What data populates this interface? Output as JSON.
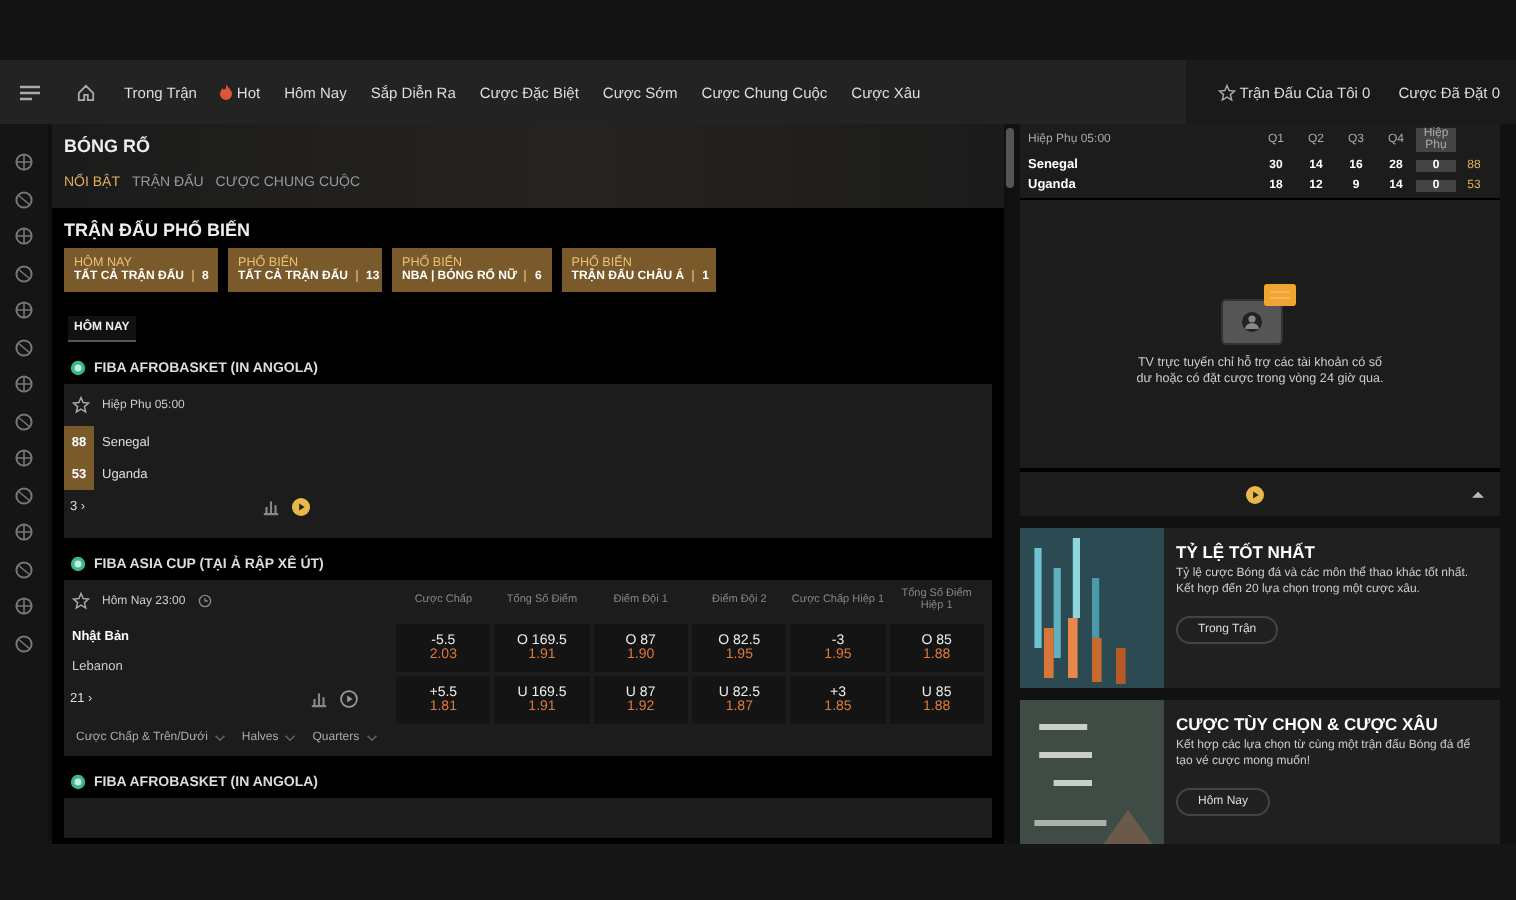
{
  "nav": {
    "items": [
      {
        "label": "Trong Trận",
        "kind": "text"
      },
      {
        "label": "Hot",
        "kind": "hot"
      },
      {
        "label": "Hôm Nay",
        "kind": "text"
      },
      {
        "label": "Sắp Diễn Ra",
        "kind": "text"
      },
      {
        "label": "Cược Đặc Biệt",
        "kind": "text"
      },
      {
        "label": "Cược Sớm",
        "kind": "text"
      },
      {
        "label": "Cược Chung Cuộc",
        "kind": "text"
      },
      {
        "label": "Cược Xâu",
        "kind": "text"
      }
    ],
    "my_matches": "Trận Đấu Của Tôi 0",
    "placed_bets": "Cược Đã Đặt 0"
  },
  "sport": {
    "title": "BÓNG RỔ",
    "tabs": [
      {
        "label": "NỔI BẬT",
        "selected": true
      },
      {
        "label": "TRẬN ĐẤU",
        "selected": false
      },
      {
        "label": "CƯỢC CHUNG CUỘC",
        "selected": false
      }
    ]
  },
  "popular": {
    "title": "TRẬN ĐẤU PHỔ BIẾN",
    "cards": [
      {
        "label": "HÔM NAY",
        "title": "TẤT CẢ TRẬN ĐẤU",
        "count": "8"
      },
      {
        "label": "PHỔ BIẾN",
        "title": "TẤT CẢ TRẬN ĐẤU",
        "count": "13"
      },
      {
        "label": "PHỔ BIẾN",
        "title": "NBA | BÓNG RỔ NỮ",
        "count": "6"
      },
      {
        "label": "PHỔ BIẾN",
        "title": "TRẬN ĐẤU CHÂU Á",
        "count": "1"
      }
    ]
  },
  "day_chip": "HÔM NAY",
  "leagues": [
    {
      "name": "FIBA AFROBASKET (IN ANGOLA)",
      "kind": "live",
      "status": "Hiệp Phụ 05:00",
      "teams": [
        {
          "name": "Senegal",
          "score": "88"
        },
        {
          "name": "Uganda",
          "score": "53"
        }
      ],
      "more": "3 ›"
    },
    {
      "name": "FIBA ASIA CUP (TẠI Ả RẬP XÊ ÚT)",
      "kind": "odds",
      "status": "Hôm Nay 23:00",
      "columns": [
        "Cược Chấp",
        "Tổng Số Điểm",
        "Điểm Đội 1",
        "Điểm Đội 2",
        "Cược Chấp Hiệp 1",
        "Tổng Số Điểm Hiệp 1"
      ],
      "teams": [
        {
          "name": "Nhật Bản",
          "bold": true
        },
        {
          "name": "Lebanon",
          "bold": false
        }
      ],
      "more": "21 ›",
      "odds": [
        [
          {
            "line": "-5.5",
            "price": "2.03"
          },
          {
            "line": "O 169.5",
            "price": "1.91"
          },
          {
            "line": "O 87",
            "price": "1.90"
          },
          {
            "line": "O 82.5",
            "price": "1.95"
          },
          {
            "line": "-3",
            "price": "1.95"
          },
          {
            "line": "O 85",
            "price": "1.88"
          }
        ],
        [
          {
            "line": "+5.5",
            "price": "1.81"
          },
          {
            "line": "U 169.5",
            "price": "1.91"
          },
          {
            "line": "U 87",
            "price": "1.92"
          },
          {
            "line": "U 82.5",
            "price": "1.87"
          },
          {
            "line": "+3",
            "price": "1.85"
          },
          {
            "line": "U 85",
            "price": "1.88"
          }
        ]
      ],
      "filters": [
        "Cược Chấp & Trên/Dưới",
        "Halves",
        "Quarters"
      ]
    },
    {
      "name": "FIBA AFROBASKET (IN ANGOLA)",
      "kind": "header"
    }
  ],
  "scoreboard": {
    "status": "Hiệp Phụ 05:00",
    "columns": [
      "Q1",
      "Q2",
      "Q3",
      "Q4",
      "Hiệp Phụ"
    ],
    "rows": [
      {
        "team": "Senegal",
        "periods": [
          "30",
          "14",
          "16",
          "28",
          "0"
        ],
        "total": "88"
      },
      {
        "team": "Uganda",
        "periods": [
          "18",
          "12",
          "9",
          "14",
          "0"
        ],
        "total": "53"
      }
    ]
  },
  "tv_message": "TV trực tuyến chỉ hỗ trợ các tài khoản có số dư hoặc có đặt cược trong vòng 24 giờ qua.",
  "promos": [
    {
      "title": "TỶ LỆ TỐT NHẤT",
      "text": "Tỷ lệ cược Bóng đá và các môn thể thao khác tốt nhất. Kết hợp đến 20 lựa chọn trong một cược xâu.",
      "button": "Trong Trận",
      "kind": "chart"
    },
    {
      "title": "CƯỢC TÙY CHỌN & CƯỢC XÂU",
      "text": "Kết hợp các lựa chọn từ cùng một trận đấu Bóng đá để tạo vé cược mong muốn!",
      "button": "Hôm Nay",
      "kind": "board"
    }
  ]
}
